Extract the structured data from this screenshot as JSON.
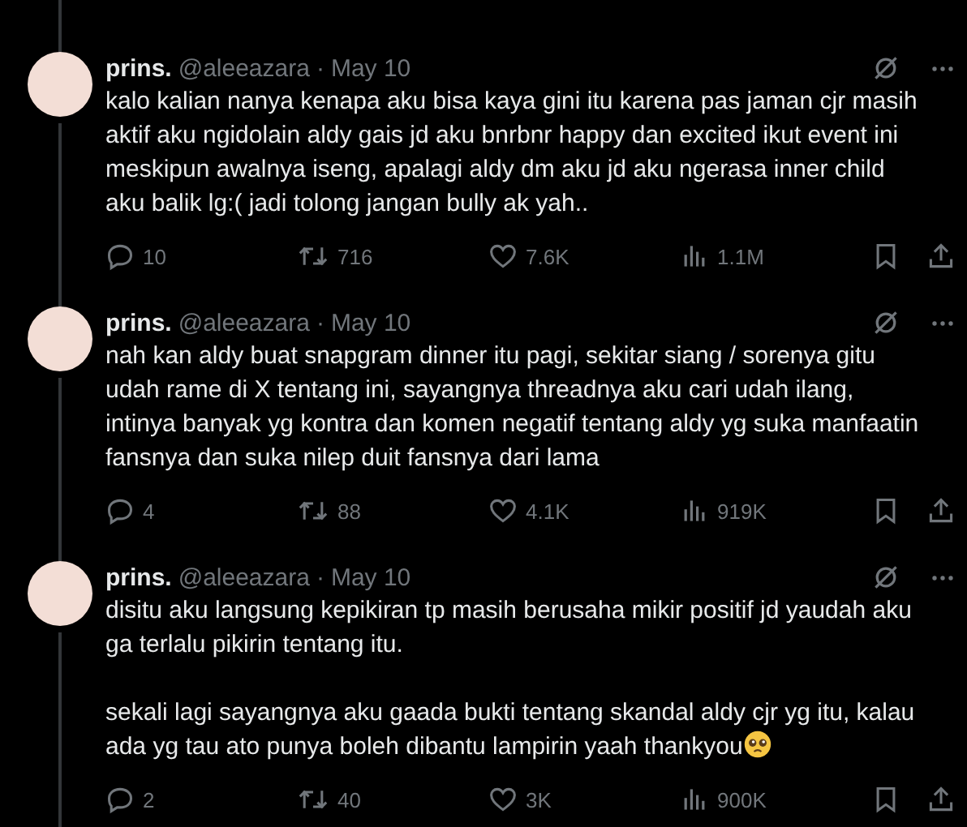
{
  "tweets": [
    {
      "name": "prins.",
      "handle": "@aleeazara",
      "separator": "·",
      "date": "May 10",
      "paragraphs": [
        "kalo kalian nanya kenapa aku bisa kaya gini itu karena pas jaman cjr masih aktif aku ngidolain aldy gais jd aku bnrbnr happy dan excited ikut event ini meskipun awalnya iseng, apalagi aldy dm aku jd aku ngerasa inner child aku balik lg:( jadi tolong jangan bully ak yah.."
      ],
      "emoji": false,
      "replies": "10",
      "reposts": "716",
      "likes": "7.6K",
      "views": "1.1M"
    },
    {
      "name": "prins.",
      "handle": "@aleeazara",
      "separator": "·",
      "date": "May 10",
      "paragraphs": [
        "nah kan aldy buat snapgram dinner itu pagi, sekitar siang / sorenya gitu udah rame di X tentang ini, sayangnya threadnya aku cari udah ilang, intinya banyak yg kontra dan komen negatif tentang aldy yg suka manfaatin fansnya dan suka nilep duit fansnya dari lama"
      ],
      "emoji": false,
      "replies": "4",
      "reposts": "88",
      "likes": "4.1K",
      "views": "919K"
    },
    {
      "name": "prins.",
      "handle": "@aleeazara",
      "separator": "·",
      "date": "May 10",
      "paragraphs": [
        "disitu aku langsung kepikiran tp masih berusaha mikir positif jd yaudah aku ga terlalu pikirin tentang itu.",
        "sekali lagi sayangnya aku gaada bukti tentang skandal aldy cjr yg itu, kalau ada yg tau ato punya boleh dibantu lampirin yaah thankyou"
      ],
      "emoji": true,
      "replies": "2",
      "reposts": "40",
      "likes": "3K",
      "views": "900K"
    }
  ]
}
